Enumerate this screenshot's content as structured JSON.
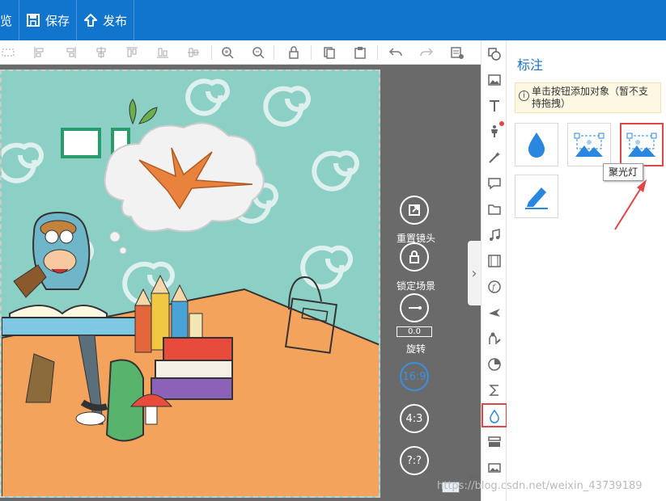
{
  "topbar": {
    "preview_label": "览",
    "save_label": "保存",
    "publish_label": "发布"
  },
  "canvas_tools": {
    "reset_camera_label": "重置镜头",
    "lock_scene_label": "锁定场景",
    "rotate_value": "0.0",
    "rotate_label": "旋转",
    "ratio_16_9": "16:9",
    "ratio_4_3": "4:3",
    "ratio_custom": "?:?"
  },
  "panel": {
    "title": "标注",
    "hint": "单击按钮添加对象（暂不支持拖拽）",
    "hint_icon": "i",
    "tooltip": "聚光灯"
  },
  "watermark": "https://blog.csdn.net/weixin_43739189",
  "colors": {
    "brand_blue": "#1275cd",
    "highlight_red": "#e14545",
    "accent_blue": "#2a86df",
    "canvas_teal": "#8ccfc5",
    "floor_orange": "#f4a35c"
  }
}
